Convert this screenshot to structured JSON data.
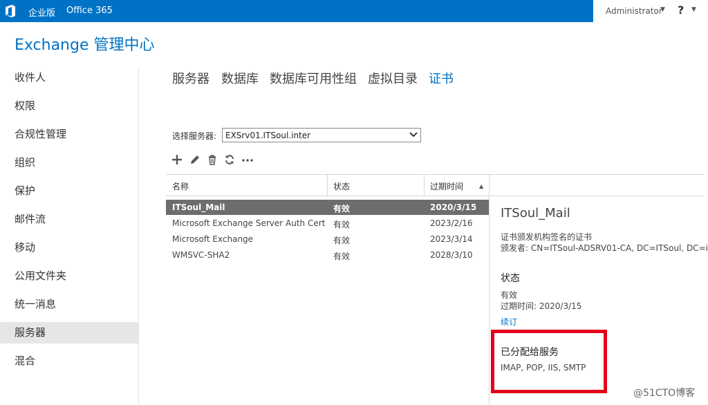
{
  "topbar": {
    "edition": "企业版",
    "office": "Office 365",
    "admin": "Administrator",
    "help": "?",
    "color": "#0072c6"
  },
  "app_title": "Exchange 管理中心",
  "nav": {
    "items": [
      {
        "label": "收件人"
      },
      {
        "label": "权限"
      },
      {
        "label": "合规性管理"
      },
      {
        "label": "组织"
      },
      {
        "label": "保护"
      },
      {
        "label": "邮件流"
      },
      {
        "label": "移动"
      },
      {
        "label": "公用文件夹"
      },
      {
        "label": "统一消息"
      },
      {
        "label": "服务器",
        "active": true
      },
      {
        "label": "混合"
      }
    ]
  },
  "tabs": [
    {
      "label": "服务器"
    },
    {
      "label": "数据库"
    },
    {
      "label": "数据库可用性组"
    },
    {
      "label": "虚拟目录"
    },
    {
      "label": "证书",
      "active": true
    }
  ],
  "server_select": {
    "label": "选择服务器:",
    "value": "EXSrv01.ITSoul.inter"
  },
  "toolbar": [
    "add-icon",
    "edit-icon",
    "delete-icon",
    "refresh-icon",
    "more-icon"
  ],
  "grid": {
    "columns": [
      "名称",
      "状态",
      "过期时间"
    ],
    "sort_column": "过期时间",
    "rows": [
      {
        "name": "ITSoul_Mail",
        "status": "有效",
        "expires": "2020/3/15",
        "selected": true
      },
      {
        "name": "Microsoft Exchange Server Auth Certific...",
        "status": "有效",
        "expires": "2023/2/16"
      },
      {
        "name": "Microsoft Exchange",
        "status": "有效",
        "expires": "2023/3/14"
      },
      {
        "name": "WMSVC-SHA2",
        "status": "有效",
        "expires": "2028/3/10"
      }
    ]
  },
  "details": {
    "title": "ITSoul_Mail",
    "type": "证书颁发机构签名的证书",
    "issuer": "颁发者: CN=ITSoul-ADSRV01-CA, DC=ITSoul, DC=inter",
    "status_heading": "状态",
    "status_value": "有效",
    "expires": "过期时间: 2020/3/15",
    "renew_link": "续订",
    "services_heading": "已分配给服务",
    "services_value": "IMAP, POP, IIS, SMTP"
  },
  "watermark": "@51CTO博客",
  "colors": {
    "accent": "#0072c6",
    "selected_row": "#6d6d6d",
    "highlight": "#e3001b"
  }
}
